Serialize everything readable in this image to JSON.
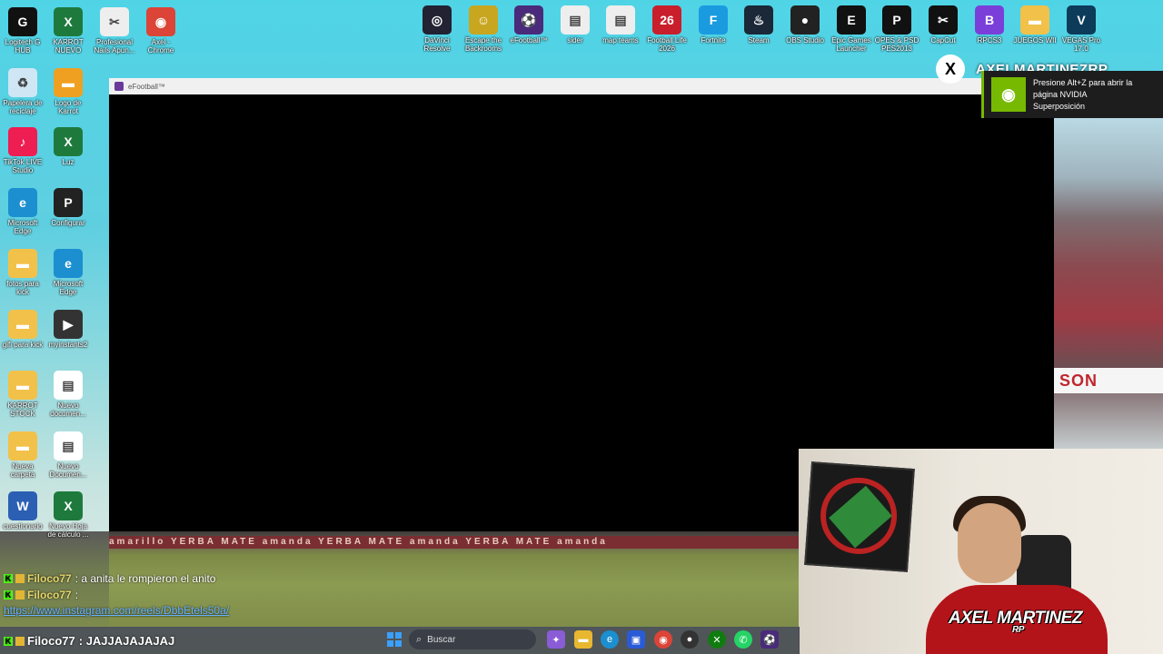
{
  "desktop": {
    "left_icons": [
      {
        "label": "Logitech G HUB",
        "glyph": "G",
        "color": "#111"
      },
      {
        "label": "KARROT NUEVO",
        "glyph": "X",
        "color": "#1e7a3c"
      },
      {
        "label": "Profesional Nails Apun...",
        "glyph": "✂",
        "color": "#eee"
      },
      {
        "label": "Axel - Chrome",
        "glyph": "◉",
        "color": "#db4437"
      },
      {
        "label": "Papelera de reciclaje",
        "glyph": "♻",
        "color": "#cfe6f5"
      },
      {
        "label": "Logo de Karrot",
        "glyph": "▬",
        "color": "#f0a020"
      },
      {
        "label": "TikTok LIVE Studio",
        "glyph": "♪",
        "color": "#ee1d52"
      },
      {
        "label": "Luz",
        "glyph": "X",
        "color": "#1e7a3c"
      },
      {
        "label": "Microsoft Edge",
        "glyph": "e",
        "color": "#1b8fd0"
      },
      {
        "label": "Configurar",
        "glyph": "P",
        "color": "#222"
      },
      {
        "label": "fotos para kick",
        "glyph": "▬",
        "color": "#f2c14a"
      },
      {
        "label": "Microsoft Edge",
        "glyph": "e",
        "color": "#1b8fd0"
      },
      {
        "label": "gifi para kick",
        "glyph": "▬",
        "color": "#f2c14a"
      },
      {
        "label": "myinstants2",
        "glyph": "▶",
        "color": "#333"
      },
      {
        "label": "KARROT STOCK",
        "glyph": "▬",
        "color": "#f2c14a"
      },
      {
        "label": "Nuevo documen...",
        "glyph": "▤",
        "color": "#fff"
      },
      {
        "label": "Nueva carpeta",
        "glyph": "▬",
        "color": "#f2c14a"
      },
      {
        "label": "Nuevo Documen...",
        "glyph": "▤",
        "color": "#fff"
      },
      {
        "label": "cuestionario",
        "glyph": "W",
        "color": "#2b5fb3"
      },
      {
        "label": "Nuevo Hoja de cálculo ...",
        "glyph": "X",
        "color": "#1e7a3c"
      }
    ],
    "top_icons": [
      {
        "label": "DaVinci Resolve",
        "glyph": "◎",
        "color": "#223"
      },
      {
        "label": "Escape the Backrooms",
        "glyph": "☺",
        "color": "#c9a620"
      },
      {
        "label": "eFootball™",
        "glyph": "⚽",
        "color": "#4a2a7a"
      },
      {
        "label": "sider",
        "glyph": "▤",
        "color": "#eee"
      },
      {
        "label": "map teams",
        "glyph": "▤",
        "color": "#eee"
      },
      {
        "label": "Football Life 2026",
        "glyph": "26",
        "color": "#c91e2b"
      },
      {
        "label": "Fortnite",
        "glyph": "F",
        "color": "#1a9be0"
      },
      {
        "label": "Steam",
        "glyph": "♨",
        "color": "#1b2838"
      },
      {
        "label": "OBS Studio",
        "glyph": "●",
        "color": "#222"
      },
      {
        "label": "Epic Games Launcher",
        "glyph": "E",
        "color": "#111"
      },
      {
        "label": "OPES & PSD PES2013",
        "glyph": "P",
        "color": "#111"
      },
      {
        "label": "CapCut",
        "glyph": "✂",
        "color": "#111"
      },
      {
        "label": "RPCS3",
        "glyph": "B",
        "color": "#7b3fd9"
      },
      {
        "label": "JUEGOS WII",
        "glyph": "▬",
        "color": "#f2c14a"
      },
      {
        "label": "VEGAS Pro 17.0",
        "glyph": "V",
        "color": "#0d3b5a"
      }
    ],
    "stadium_banner": "SON"
  },
  "window": {
    "title": "eFootball™"
  },
  "x_overlay": {
    "icon": "x-logo-icon",
    "handle": "AXELMARTINEZRP"
  },
  "nvidia": {
    "line1": "Presione Alt+Z para abrir la",
    "line2": "página NVIDIA",
    "line3": "Superposición",
    "accent": "#76b900"
  },
  "webcam": {
    "logo_main": "AXEL MARTINEZ",
    "logo_sub": "RP"
  },
  "chat": {
    "messages": [
      {
        "user": "Filoco77",
        "text": ": a anita le rompieron el anito"
      },
      {
        "user": "Filoco77",
        "text": ":"
      }
    ],
    "link": "https://www.instagram.com/reels/DbbEtels50a/",
    "last": {
      "user": "Filoco77",
      "text": ": JAJJAJAJAJAJ"
    }
  },
  "pitch": {
    "ads": "amarillo  YERBA  MATE  amanda  YERBA  MATE  amanda  YERBA  MATE  amanda"
  },
  "taskbar": {
    "search_placeholder": "Buscar"
  }
}
